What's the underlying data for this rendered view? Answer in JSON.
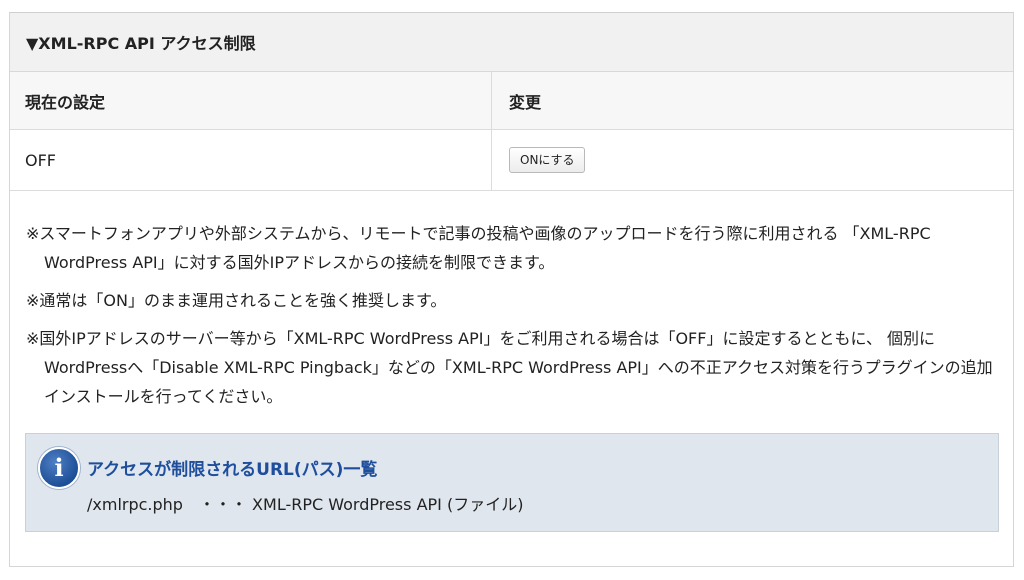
{
  "panel": {
    "title": "▼XML-RPC API アクセス制限"
  },
  "table": {
    "headers": [
      "現在の設定",
      "変更"
    ],
    "current_value": "OFF",
    "toggle_button_label": "ONにする"
  },
  "notes": [
    "※スマートフォンアプリや外部システムから、リモートで記事の投稿や画像のアップロードを行う際に利用される 「XML-RPC WordPress API」に対する国外IPアドレスからの接続を制限できます。",
    "※通常は「ON」のまま運用されることを強く推奨します。",
    "※国外IPアドレスのサーバー等から「XML-RPC WordPress API」をご利用される場合は「OFF」に設定するとともに、 個別にWordPressへ「Disable XML-RPC Pingback」などの「XML-RPC WordPress API」への不正アクセス対策を行うプラグインの追加インストールを行ってください。"
  ],
  "info": {
    "icon": "info-icon",
    "title": "アクセスが制限されるURL(パス)一覧",
    "entry": "/xmlrpc.php　・・・ XML-RPC WordPress API (ファイル)"
  },
  "colors": {
    "info_background": "#dfe6ee",
    "info_title": "#1f4e9c"
  }
}
